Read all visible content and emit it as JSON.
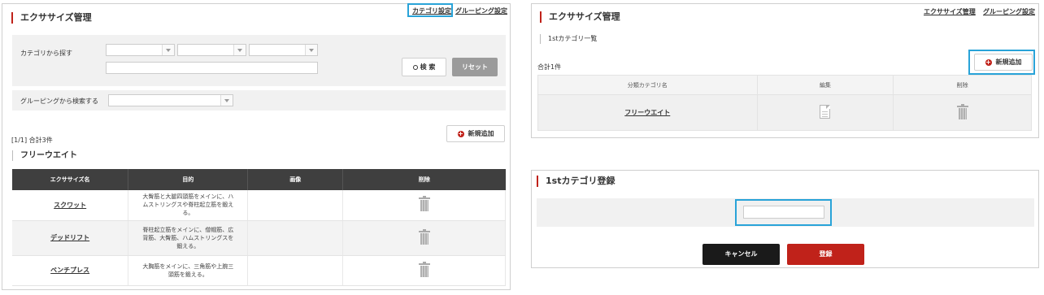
{
  "left": {
    "title": "エクササイズ管理",
    "links": {
      "category": "カテゴリ設定",
      "grouping": "グルーピング設定"
    },
    "search": {
      "category_label": "カテゴリから探す",
      "grouping_label": "グルーピングから検索する",
      "search_button": "検 索",
      "reset_button": "リセット"
    },
    "count": "[1/1] 合計3件",
    "add_button": "新規追加",
    "group_title": "フリーウエイト",
    "table": {
      "headers": [
        "エクササイズ名",
        "目的",
        "画像",
        "削除"
      ],
      "rows": [
        {
          "name": "スクワット",
          "purpose": "大臀筋と大腿四頭筋をメインに、ハムストリングスや脊柱起立筋を鍛える。"
        },
        {
          "name": "デッドリフト",
          "purpose": "脊柱起立筋をメインに、僧帽筋、広背筋、大臀筋、ハムストリングスを鍛える。"
        },
        {
          "name": "ベンチプレス",
          "purpose": "大胸筋をメインに、三角筋や上腕三頭筋を鍛える。"
        }
      ]
    }
  },
  "right_top": {
    "title": "エクササイズ管理",
    "links": {
      "exercise": "エクササイズ管理",
      "grouping": "グルーピング設定"
    },
    "subtitle": "1stカテゴリ一覧",
    "count": "合計1件",
    "add_button": "新規追加",
    "table": {
      "headers": [
        "分類カテゴリ名",
        "編集",
        "削除"
      ],
      "rows": [
        {
          "name": "フリーウエイト"
        }
      ]
    }
  },
  "right_bottom": {
    "title": "1stカテゴリ登録",
    "cancel_button": "キャンセル",
    "submit_button": "登録"
  },
  "colors": {
    "accent": "#c0221a",
    "highlight": "#29a3d8",
    "dark": "#1a1a1a"
  }
}
